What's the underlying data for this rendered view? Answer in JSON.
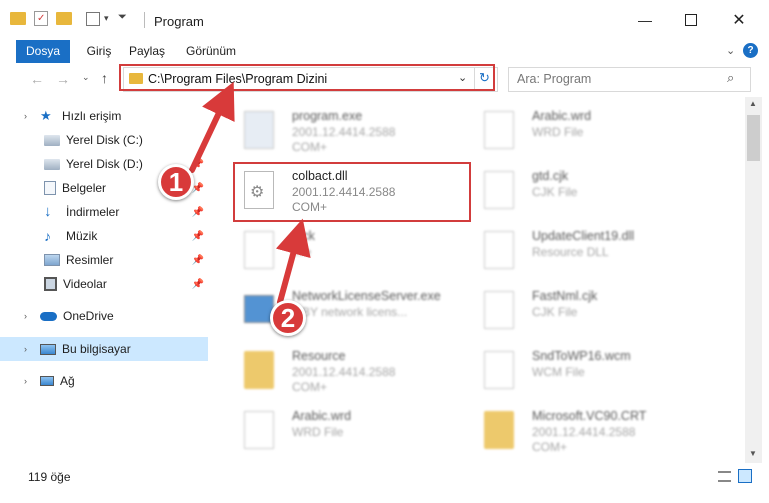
{
  "window": {
    "title": "Program",
    "qat_items": [
      "folder-icon",
      "properties-icon",
      "new-folder-icon",
      "customize-icon"
    ],
    "controls": [
      "minimize-icon",
      "maximize-icon",
      "close-icon"
    ]
  },
  "ribbon": {
    "tabs": [
      {
        "label": "Dosya",
        "active": true
      },
      {
        "label": "Giriş"
      },
      {
        "label": "Paylaş"
      },
      {
        "label": "Görünüm"
      }
    ]
  },
  "address": {
    "path": "C:\\Program Files\\Program Dizini",
    "search_placeholder": "Ara: Program"
  },
  "nav": {
    "items": [
      {
        "label": "Hızlı erişim",
        "icon": "star-icon"
      },
      {
        "label": "Yerel Disk (C:)",
        "icon": "drive-icon"
      },
      {
        "label": "Yerel Disk (D:)",
        "icon": "drive-icon"
      },
      {
        "label": "Belgeler",
        "icon": "documents-icon"
      },
      {
        "label": "İndirmeler",
        "icon": "download-icon"
      },
      {
        "label": "Müzik",
        "icon": "music-icon"
      },
      {
        "label": "Resimler",
        "icon": "pictures-icon"
      },
      {
        "label": "Videolar",
        "icon": "video-icon"
      },
      {
        "label": "OneDrive",
        "icon": "cloud-icon"
      },
      {
        "label": "Bu bilgisayar",
        "icon": "computer-icon"
      },
      {
        "label": "Ağ",
        "icon": "network-icon"
      }
    ]
  },
  "files": {
    "left": [
      {
        "name": "program.exe",
        "l2": "2001.12.4414.2588",
        "l3": "COM+"
      },
      {
        "name": "colbact.dll",
        "l2": "2001.12.4414.2588",
        "l3": "COM+"
      },
      {
        "name": "...ck",
        "l2": "...le",
        "l3": ""
      },
      {
        "name": "NetworkLicenseServer.exe",
        "l2": "...BY network licens...",
        "l3": ""
      },
      {
        "name": "Resource",
        "l2": "2001.12.4414.2588",
        "l3": "COM+"
      },
      {
        "name": "Arabic.wrd",
        "l2": "WRD File",
        "l3": ""
      }
    ],
    "right": [
      {
        "name": "Arabic.wrd",
        "l2": "WRD File",
        "l3": ""
      },
      {
        "name": "gtd.cjk",
        "l2": "CJK File",
        "l3": ""
      },
      {
        "name": "UpdateClient19.dll",
        "l2": "Resource DLL",
        "l3": ""
      },
      {
        "name": "FastNml.cjk",
        "l2": "CJK File",
        "l3": ""
      },
      {
        "name": "SndToWP16.wcm",
        "l2": "WCM File",
        "l3": ""
      },
      {
        "name": "Microsoft.VC90.CRT",
        "l2": "2001.12.4414.2588",
        "l3": "COM+"
      }
    ]
  },
  "status": {
    "count": "119 öğe"
  },
  "annotations": {
    "badge1": "1",
    "badge2": "2"
  },
  "colors": {
    "accent": "#1a6fc5",
    "highlight": "#d23c3c",
    "selection": "#cce8ff"
  }
}
